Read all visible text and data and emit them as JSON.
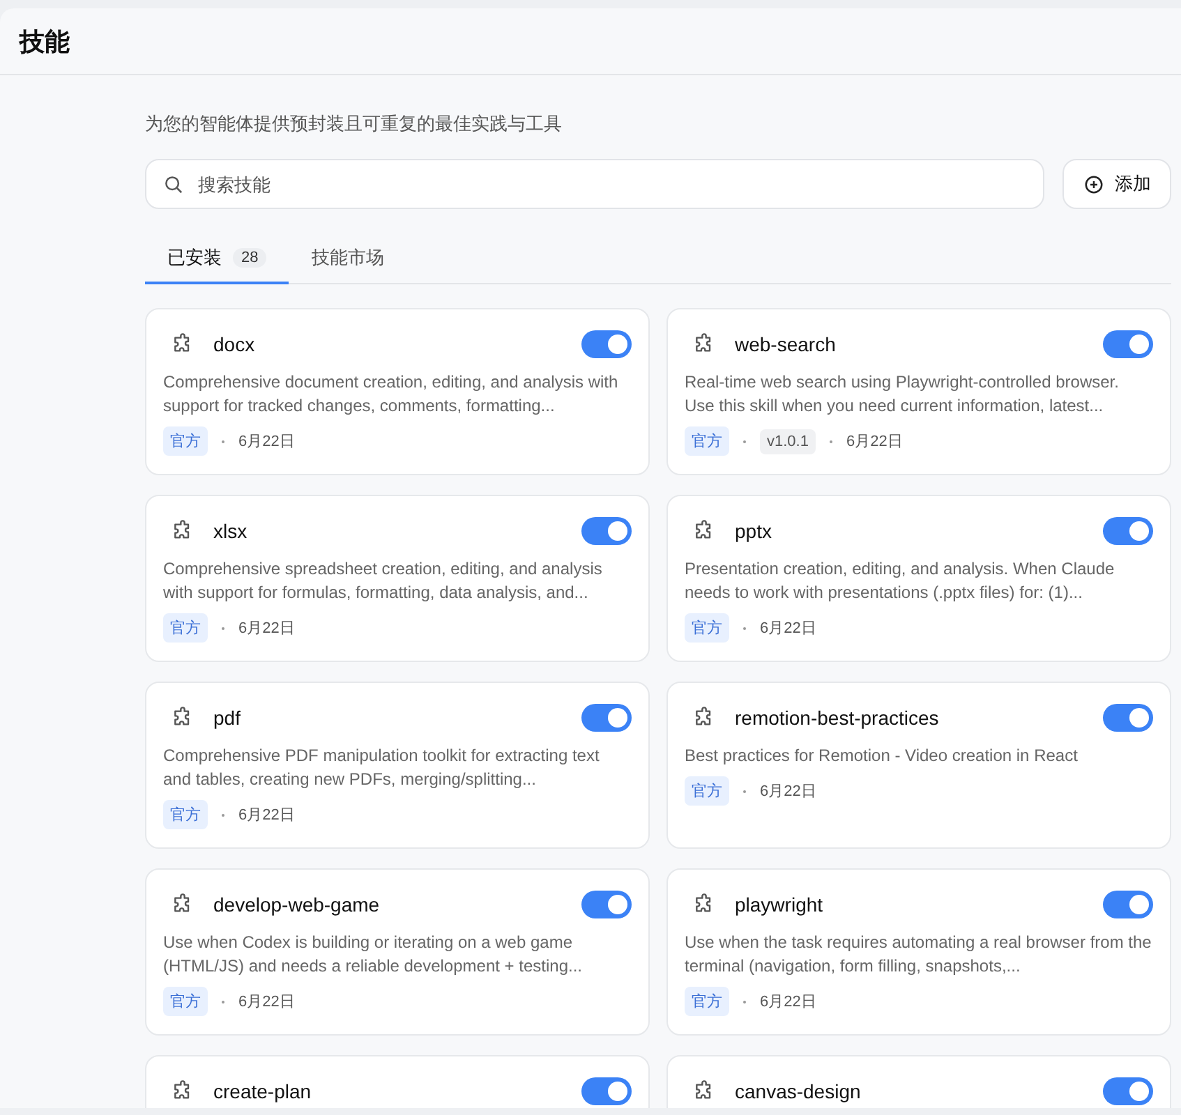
{
  "header": {
    "title": "技能"
  },
  "subtitle": "为您的智能体提供预封装且可重复的最佳实践与工具",
  "search": {
    "placeholder": "搜索技能"
  },
  "add_button": {
    "label": "添加"
  },
  "tabs": [
    {
      "label": "已安装",
      "count": "28",
      "selected": true
    },
    {
      "label": "技能市场",
      "selected": false
    }
  ],
  "skills": [
    {
      "name": "docx",
      "on": true,
      "description": "Comprehensive document creation, editing, and analysis with support for tracked changes, comments, formatting...",
      "tag": "官方",
      "date": "6月22日"
    },
    {
      "name": "web-search",
      "on": true,
      "description": "Real-time web search using Playwright-controlled browser. Use this skill when you need current information, latest...",
      "tag": "官方",
      "version": "v1.0.1",
      "date": "6月22日"
    },
    {
      "name": "xlsx",
      "on": true,
      "description": "Comprehensive spreadsheet creation, editing, and analysis with support for formulas, formatting, data analysis, and...",
      "tag": "官方",
      "date": "6月22日"
    },
    {
      "name": "pptx",
      "on": true,
      "description": "Presentation creation, editing, and analysis. When Claude needs to work with presentations (.pptx files) for: (1)...",
      "tag": "官方",
      "date": "6月22日"
    },
    {
      "name": "pdf",
      "on": true,
      "description": "Comprehensive PDF manipulation toolkit for extracting text and tables, creating new PDFs, merging/splitting...",
      "tag": "官方",
      "date": "6月22日"
    },
    {
      "name": "remotion-best-practices",
      "on": true,
      "description": "Best practices for Remotion - Video creation in React",
      "tag": "官方",
      "date": "6月22日"
    },
    {
      "name": "develop-web-game",
      "on": true,
      "description": "Use when Codex is building or iterating on a web game (HTML/JS) and needs a reliable development + testing...",
      "tag": "官方",
      "date": "6月22日"
    },
    {
      "name": "playwright",
      "on": true,
      "description": "Use when the task requires automating a real browser from the terminal (navigation, form filling, snapshots,...",
      "tag": "官方",
      "date": "6月22日"
    },
    {
      "name": "create-plan",
      "on": true
    },
    {
      "name": "canvas-design",
      "on": true
    }
  ]
}
